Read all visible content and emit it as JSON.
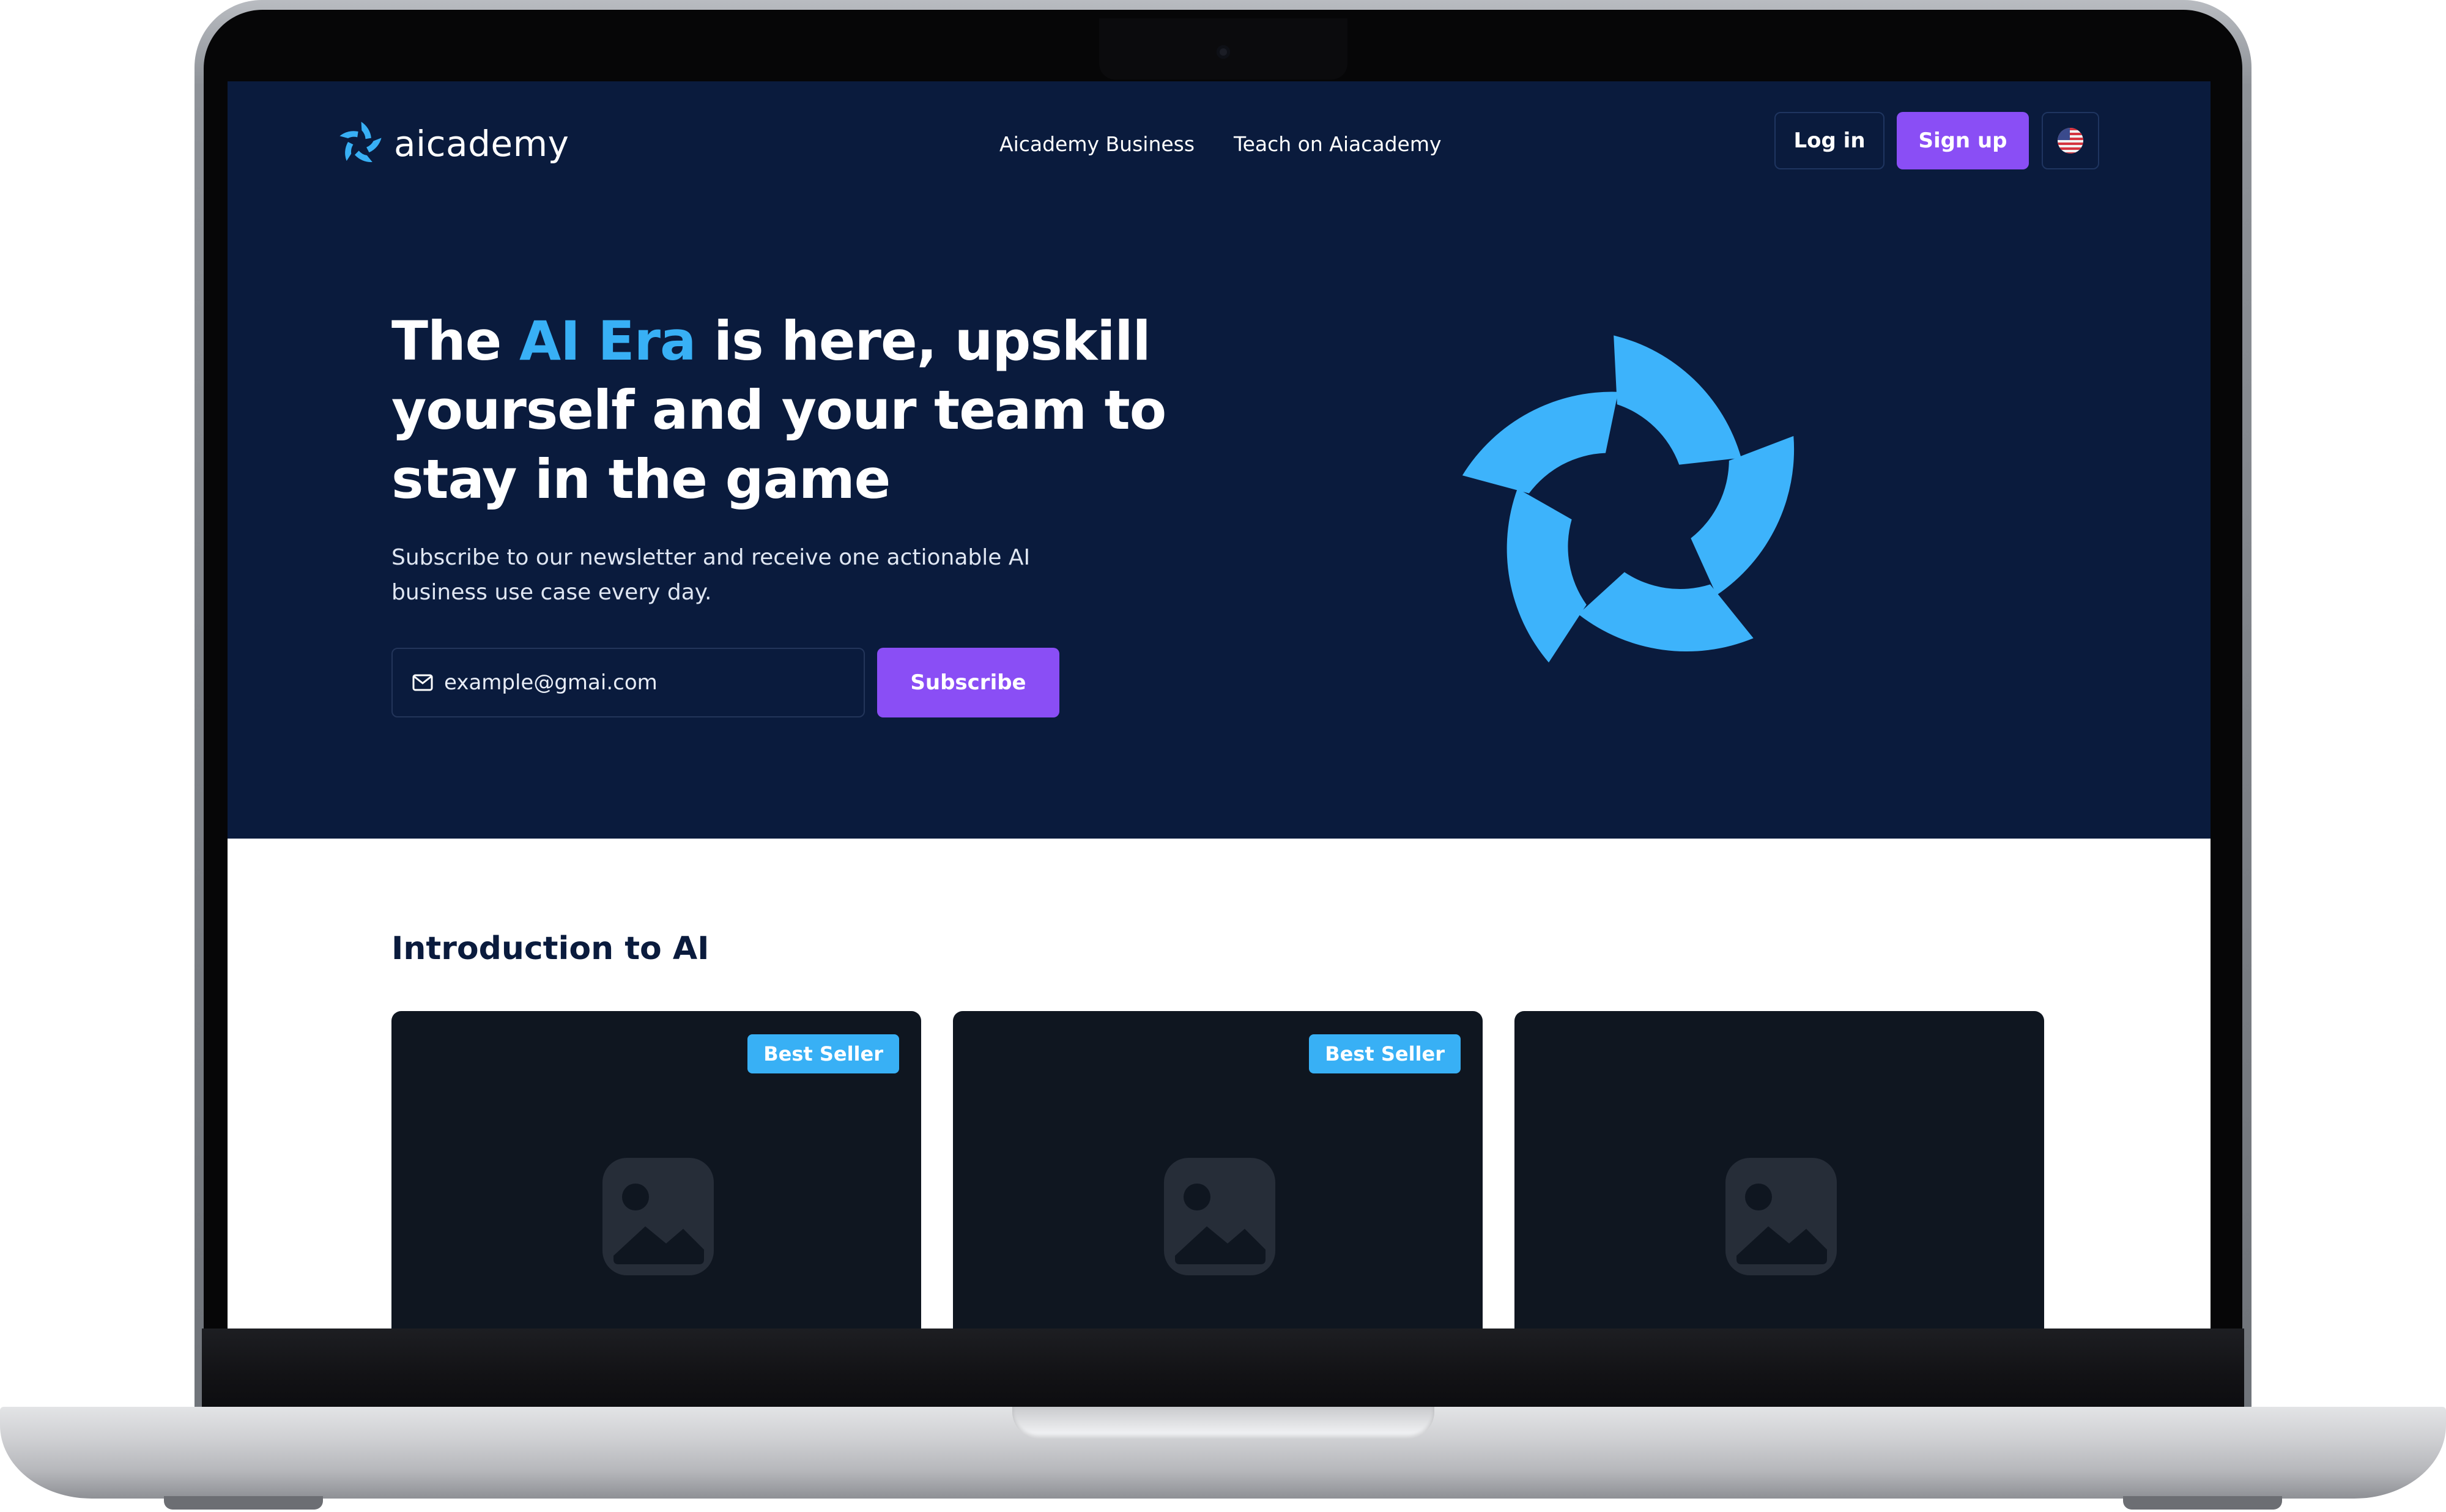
{
  "brand": {
    "name": "aicademy",
    "accent_color": "#38b0f5"
  },
  "nav": {
    "links": [
      "Aicademy Business",
      "Teach on Aiacademy"
    ],
    "login_label": "Log in",
    "signup_label": "Sign up",
    "language_icon": "us-flag-icon"
  },
  "hero": {
    "headline_before": "The ",
    "headline_accent": "AI Era",
    "headline_after": " is here, upskill yourself and your team to stay in the game",
    "subtext": "Subscribe to our newsletter and receive one actionable AI business use case every day.",
    "email_placeholder": "example@gmai.com",
    "subscribe_label": "Subscribe",
    "background_color": "#0a1b3d",
    "button_color": "#8a4ef5"
  },
  "courses": {
    "section_title": "Introduction to AI",
    "cards": [
      {
        "badge": "Best Seller",
        "image_icon": "image-placeholder-icon"
      },
      {
        "badge": "Best Seller",
        "image_icon": "image-placeholder-icon"
      },
      {
        "badge": "",
        "image_icon": "image-placeholder-icon"
      }
    ]
  }
}
